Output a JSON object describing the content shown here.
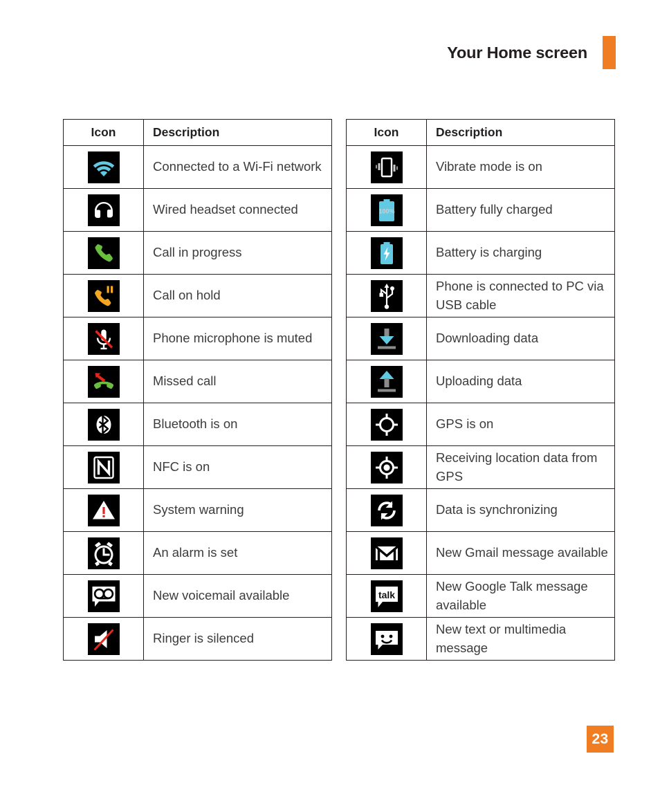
{
  "header": {
    "title": "Your Home screen",
    "accent_color": "#f07d22"
  },
  "tables": {
    "columns": {
      "icon": "Icon",
      "description": "Description"
    },
    "left": [
      {
        "icon": "wifi-connected-icon",
        "description": "Connected to a Wi-Fi network"
      },
      {
        "icon": "wired-headset-icon",
        "description": "Wired headset connected"
      },
      {
        "icon": "call-in-progress-icon",
        "description": "Call in progress"
      },
      {
        "icon": "call-on-hold-icon",
        "description": "Call on hold"
      },
      {
        "icon": "microphone-muted-icon",
        "description": "Phone microphone is muted"
      },
      {
        "icon": "missed-call-icon",
        "description": "Missed call"
      },
      {
        "icon": "bluetooth-on-icon",
        "description": "Bluetooth is on"
      },
      {
        "icon": "nfc-on-icon",
        "description": "NFC is on"
      },
      {
        "icon": "system-warning-icon",
        "description": "System warning"
      },
      {
        "icon": "alarm-set-icon",
        "description": "An alarm is set"
      },
      {
        "icon": "voicemail-icon",
        "description": "New voicemail available"
      },
      {
        "icon": "ringer-silenced-icon",
        "description": "Ringer is silenced"
      }
    ],
    "right": [
      {
        "icon": "vibrate-mode-icon",
        "description": "Vibrate mode is on"
      },
      {
        "icon": "battery-full-icon",
        "description": "Battery fully charged",
        "badge": "100%"
      },
      {
        "icon": "battery-charging-icon",
        "description": "Battery is charging"
      },
      {
        "icon": "usb-connected-icon",
        "description": "Phone is connected to PC via USB cable"
      },
      {
        "icon": "download-icon",
        "description": "Downloading data"
      },
      {
        "icon": "upload-icon",
        "description": "Uploading data"
      },
      {
        "icon": "gps-on-icon",
        "description": "GPS is on"
      },
      {
        "icon": "gps-fix-icon",
        "description": "Receiving location data from GPS"
      },
      {
        "icon": "sync-icon",
        "description": "Data is synchronizing"
      },
      {
        "icon": "gmail-icon",
        "description": "New Gmail message available"
      },
      {
        "icon": "google-talk-icon",
        "description": "New Google Talk message available",
        "badge": "talk"
      },
      {
        "icon": "sms-mms-icon",
        "description": "New text or multimedia message"
      }
    ]
  },
  "footer": {
    "page_number": "23"
  },
  "colors": {
    "accent": "#f07d22",
    "icon_cyan": "#62c9e3",
    "icon_green": "#6bbd3f",
    "icon_orange": "#f5a623",
    "icon_red": "#e0261d",
    "icon_white": "#ffffff",
    "icon_tile_bg": "#000000",
    "text": "#3c3c3c",
    "heading": "#231f20"
  }
}
